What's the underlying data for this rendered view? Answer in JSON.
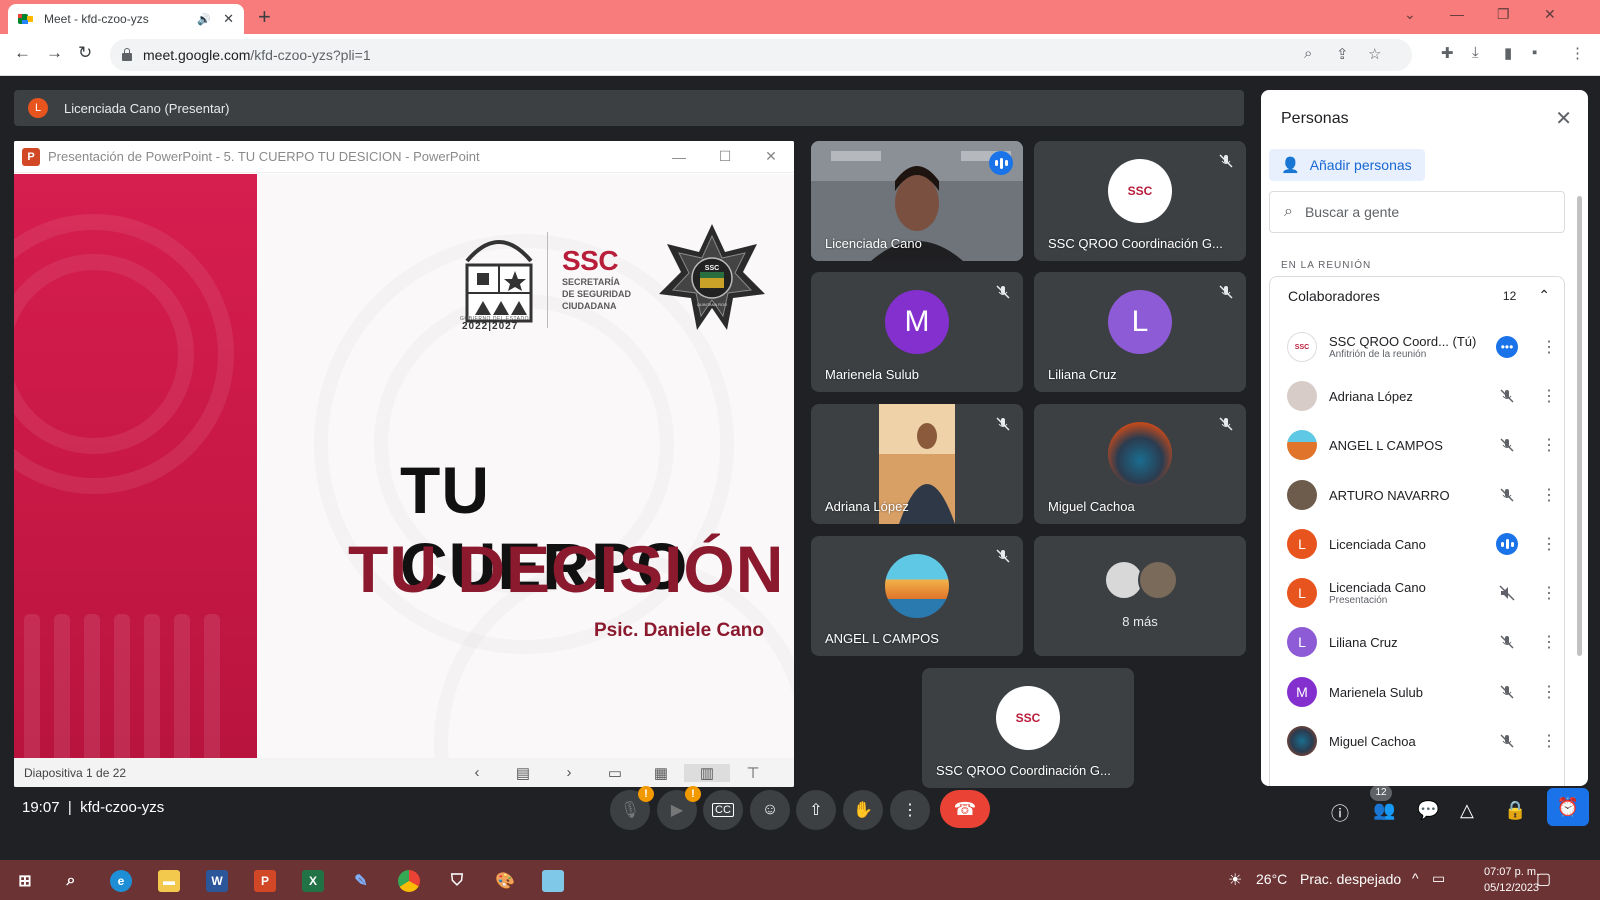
{
  "browser": {
    "tab_title": "Meet - kfd-czoo-yzs",
    "url_host": "meet.google.com",
    "url_path": "/kfd-czoo-yzs?pli=1"
  },
  "presenting_bar": {
    "avatar_letter": "L",
    "label": "Licenciada Cano (Presentar)"
  },
  "powerpoint": {
    "icon_letter": "P",
    "title": "Presentación de PowerPoint  -  5. TU CUERPO TU DESICION  -  PowerPoint",
    "slide": {
      "ssc": "SSC",
      "ssc_sub": [
        "SECRETARÍA",
        "DE SEGURIDAD",
        "CIUDADANA"
      ],
      "gob_label": "GOBIERNO DEL ESTADO",
      "gob_year": "2022|2027",
      "badge_text": "SSC",
      "badge_sub": "QUINTANA ROO",
      "headline1": "TU CUERPO",
      "headline2": "TU DECISIÓN",
      "author": "Psic. Daniele Cano"
    },
    "status": "Diapositiva 1 de 22"
  },
  "tiles": [
    {
      "name": "Licenciada Cano"
    },
    {
      "name": "SSC QROO Coordinación G..."
    },
    {
      "name": "Marienela Sulub",
      "letter": "M"
    },
    {
      "name": "Liliana Cruz",
      "letter": "L"
    },
    {
      "name": "Adriana López"
    },
    {
      "name": "Miguel Cachoa"
    },
    {
      "name": "ANGEL L CAMPOS"
    },
    {
      "name": "8 más"
    },
    {
      "name": "SSC QROO Coordinación G..."
    }
  ],
  "meeting": {
    "time": "19:07",
    "code": "kfd-czoo-yzs",
    "people_count": "12",
    "warn": "!"
  },
  "panel": {
    "title": "Personas",
    "add_people": "Añadir personas",
    "search_placeholder": "Buscar a gente",
    "section": "EN LA REUNIÓN",
    "collaborators_label": "Colaboradores",
    "collaborators_count": "12",
    "people": [
      {
        "name": "SSC QROO Coord...  (Tú)",
        "sub": "Anfitrión de la reunión",
        "letter": ""
      },
      {
        "name": "Adriana López",
        "sub": "",
        "letter": ""
      },
      {
        "name": "ANGEL L CAMPOS",
        "sub": "",
        "letter": ""
      },
      {
        "name": "ARTURO NAVARRO",
        "sub": "",
        "letter": ""
      },
      {
        "name": "Licenciada Cano",
        "sub": "",
        "letter": "L"
      },
      {
        "name": "Licenciada Cano",
        "sub": "Presentación",
        "letter": "L"
      },
      {
        "name": "Liliana Cruz",
        "sub": "",
        "letter": "L"
      },
      {
        "name": "Marienela Sulub",
        "sub": "",
        "letter": "M"
      },
      {
        "name": "Miguel Cachoa",
        "sub": "",
        "letter": ""
      }
    ]
  },
  "taskbar": {
    "temperature": "26°C",
    "weather": "Prac. despejado",
    "time": "07:07 p. m.",
    "date": "05/12/2023",
    "word_letter": "W",
    "ppt_letter": "P",
    "excel_letter": "X"
  },
  "colors": {
    "accent": "#1a73e8",
    "hangup": "#ea4335",
    "slide_red": "#c81845",
    "headline_red": "#8b1a2f",
    "tabstrip": "#f87c7c",
    "taskbar": "#6b3333"
  }
}
